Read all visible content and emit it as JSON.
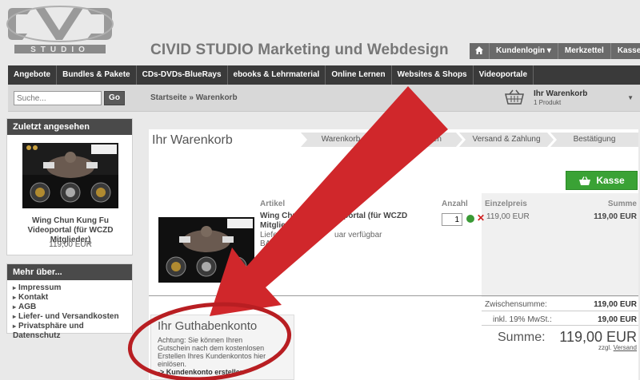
{
  "header": {
    "logo_text": "CIVID STUDIO",
    "site_title": "CIVID STUDIO Marketing und Webdesign",
    "topnav": [
      {
        "label": "Kundenlogin ▾"
      },
      {
        "label": "Merkzettel"
      },
      {
        "label": "Kasse"
      }
    ]
  },
  "mainnav": [
    "Angebote",
    "Bundles & Pakete",
    "CDs-DVDs-BlueRays",
    "ebooks & Lehrmaterial",
    "Online Lernen",
    "Websites & Shops",
    "Videoportale"
  ],
  "search": {
    "placeholder": "Suche...",
    "button": "Go"
  },
  "breadcrumb": "Startseite » Warenkorb",
  "minicart": {
    "title": "Ihr Warenkorb",
    "count": "1 Produkt"
  },
  "sidebar": {
    "recent": {
      "title": "Zuletzt angesehen",
      "product_name": "Wing Chun Kung Fu Videoportal (für WCZD Mitglieder)",
      "price": "119,00 EUR",
      "banner_text": "Selbstverteidigung online lernen"
    },
    "more": {
      "title": "Mehr über...",
      "items": [
        "Impressum",
        "Kontakt",
        "AGB",
        "Liefer- und Versandkosten",
        "Privatsphäre und Datenschutz"
      ]
    }
  },
  "cart": {
    "title": "Ihr Warenkorb",
    "steps": [
      "Warenkorb",
      "aten",
      "Versand & Zahlung",
      "Bestätigung"
    ],
    "checkout_button": "Kasse",
    "columns": {
      "article": "Artikel",
      "qty": "Anzahl",
      "unit": "Einzelpreis",
      "sum": "Summe"
    },
    "item": {
      "name_part1": "Wing Chu",
      "name_part2": "eoportal (für WCZD",
      "name_line2": "Mitglie",
      "avail_part1": "Liefer",
      "avail_part2": "uar verfügbar",
      "ba": "BA",
      "qty": "1",
      "unit_price": "119,00 EUR",
      "sum": "119,00 EUR"
    },
    "totals": {
      "subtotal_label": "Zwischensumme:",
      "subtotal": "119,00 EUR",
      "vat_label": "inkl. 19% MwSt.:",
      "vat": "19,00 EUR",
      "total_label": "Summe:",
      "total": "119,00 EUR",
      "shipping_prefix": "zzgl.",
      "shipping_link": "Versand"
    }
  },
  "credit": {
    "title": "Ihr Guthabenkonto",
    "text": "Achtung: Sie können Ihren Gutschein nach dem kostenlosen Erstellen Ihres Kundenkontos hier einlösen.",
    "link": "-> Kundenkonto erstellen"
  },
  "colors": {
    "accent_green": "#3aa235",
    "annotation_red": "#d0272b",
    "nav_dark": "#3a3a3a"
  }
}
